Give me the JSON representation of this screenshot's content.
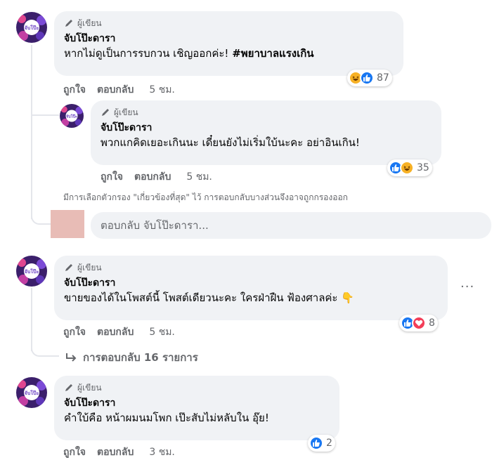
{
  "colors": {
    "like": "#1877f2",
    "love": "#f33e58",
    "haha": "#f7b125",
    "bubble": "#f0f2f5",
    "muted": "#65676b"
  },
  "comments": [
    {
      "badge": "ผู้เขียน",
      "author": "จับโป๊ะดารา",
      "text": "หากไม่ดูเป็นการรบกวน เชิญออกค่ะ!",
      "hashtag": "#พยาบาลแรงเกิน",
      "like": "ถูกใจ",
      "reply": "ตอบกลับ",
      "time": "5 ชม.",
      "reactions": {
        "icons": [
          "haha-icon",
          "like-icon"
        ],
        "count": "87"
      }
    },
    {
      "badge": "ผู้เขียน",
      "author": "จับโป๊ะดารา",
      "text": "พวกแกคิดเยอะเกินนะ เดี๋ยนยังไม่เริ่มใบ้นะคะ อย่าอินเกิน!",
      "like": "ถูกใจ",
      "reply": "ตอบกลับ",
      "time": "5 ชม.",
      "reactions": {
        "icons": [
          "like-icon",
          "haha-icon"
        ],
        "count": "35"
      }
    },
    {
      "badge": "ผู้เขียน",
      "author": "จับโป๊ะดารา",
      "text": "ขายของได้ในโพสต์นี้ โพสต์เดียวนะคะ ใครฝ่าฝืน ฟ้องศาลค่ะ",
      "emoji": "👇",
      "like": "ถูกใจ",
      "reply": "ตอบกลับ",
      "time": "5 ชม.",
      "reactions": {
        "icons": [
          "like-icon",
          "love-icon"
        ],
        "count": "8"
      }
    },
    {
      "badge": "ผู้เขียน",
      "author": "จับโป๊ะดารา",
      "text": "คำใบ้คือ หน้าผมนมโพก เป๊ะสับไม่หลับใน อุ๊ย!",
      "like": "ถูกใจ",
      "reply": "ตอบกลับ",
      "time": "3 ชม.",
      "reactions": {
        "icons": [
          "like-icon"
        ],
        "count": "2"
      }
    }
  ],
  "filter_note": "มีการเลือกตัวกรอง \"เกี่ยวข้องที่สุด\" ไว้ การตอบกลับบางส่วนจึงอาจถูกกรองออก",
  "reply_placeholder": "ตอบกลับ จับโป๊ะดารา...",
  "view_replies": "การตอบกลับ 16 รายการ",
  "more_menu": "···"
}
